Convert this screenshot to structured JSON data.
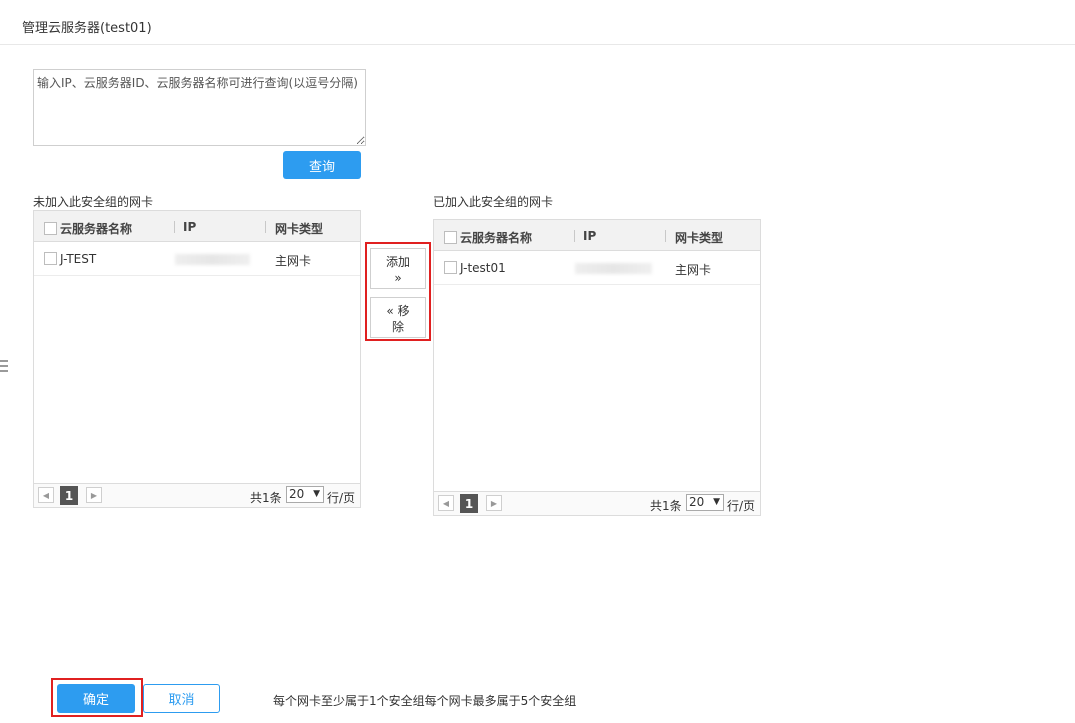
{
  "header": {
    "title": "管理云服务器(test01)"
  },
  "search": {
    "placeholder": "输入IP、云服务器ID、云服务器名称可进行查询(以逗号分隔)",
    "value": "",
    "button_label": "查询"
  },
  "left_panel": {
    "label": "未加入此安全组的网卡",
    "columns": [
      "云服务器名称",
      "IP",
      "网卡类型"
    ],
    "rows": [
      {
        "name": "J-TEST",
        "ip": "",
        "nic_type": "主网卡"
      }
    ],
    "pager": {
      "page": "1",
      "total": "共1条",
      "page_size": "20",
      "unit": "行/页"
    }
  },
  "transfer": {
    "add_line1": "添加",
    "add_line2": "»",
    "remove_line1": "« 移",
    "remove_line2": "除"
  },
  "right_panel": {
    "label": "已加入此安全组的网卡",
    "columns": [
      "云服务器名称",
      "IP",
      "网卡类型"
    ],
    "rows": [
      {
        "name": "J-test01",
        "ip": "",
        "nic_type": "主网卡"
      }
    ],
    "pager": {
      "page": "1",
      "total": "共1条",
      "page_size": "20",
      "unit": "行/页"
    }
  },
  "footer": {
    "confirm_label": "确定",
    "cancel_label": "取消",
    "note": "每个网卡至少属于1个安全组每个网卡最多属于5个安全组"
  },
  "colors": {
    "primary": "#2d9cf0",
    "highlight": "#e02020"
  }
}
